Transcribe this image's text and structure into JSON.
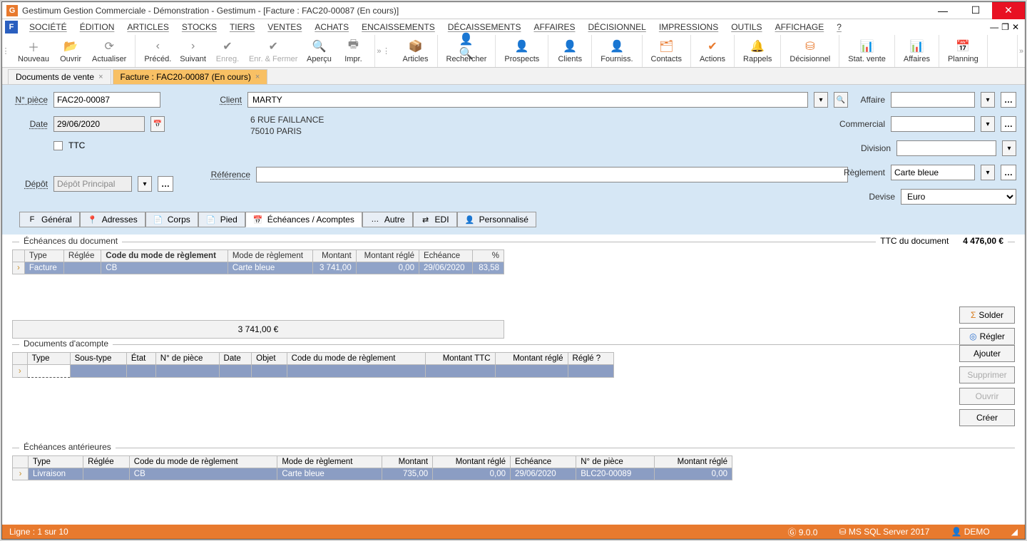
{
  "titlebar": "Gestimum Gestion Commerciale - Démonstration - Gestimum - [Facture : FAC20-00087 (En cours)]",
  "menus": [
    "SOCIÉTÉ",
    "ÉDITION",
    "ARTICLES",
    "STOCKS",
    "TIERS",
    "VENTES",
    "ACHATS",
    "ENCAISSEMENTS",
    "DÉCAISSEMENTS",
    "AFFAIRES",
    "DÉCISIONNEL",
    "IMPRESSIONS",
    "OUTILS",
    "AFFICHAGE",
    "?"
  ],
  "toolbar1": [
    {
      "label": "Nouveau",
      "icon": "＋",
      "color": "ic-grey"
    },
    {
      "label": "Ouvrir",
      "icon": "📂",
      "color": "ic-grey"
    },
    {
      "label": "Actualiser",
      "icon": "⟳",
      "color": "ic-grey"
    }
  ],
  "toolbar2": [
    {
      "label": "Précéd.",
      "icon": "‹",
      "color": "ic-grey"
    },
    {
      "label": "Suivant",
      "icon": "›",
      "color": "ic-grey"
    },
    {
      "label": "Enreg.",
      "icon": "✔",
      "color": "ic-grey",
      "disabled": true
    },
    {
      "label": "Enr. & Fermer",
      "icon": "✔",
      "color": "ic-grey",
      "disabled": true
    },
    {
      "label": "Aperçu",
      "icon": "🔍",
      "color": "ic-grey"
    },
    {
      "label": "Impr.",
      "icon": "🖶",
      "color": "ic-grey"
    }
  ],
  "toolbar3": [
    {
      "label": "Articles",
      "icon": "📦",
      "color": "ic-orange"
    },
    {
      "label": "Rechercher",
      "icon": "👤🔍",
      "color": "ic-orange"
    },
    {
      "label": "Prospects",
      "icon": "👤",
      "color": "ic-green"
    },
    {
      "label": "Clients",
      "icon": "👤",
      "color": "ic-orange"
    },
    {
      "label": "Fourniss.",
      "icon": "👤",
      "color": "ic-blue"
    },
    {
      "label": "Contacts",
      "icon": "🗂",
      "color": "ic-orange"
    },
    {
      "label": "Actions",
      "icon": "✔",
      "color": "ic-orange"
    },
    {
      "label": "Rappels",
      "icon": "🔔",
      "color": "ic-orange"
    },
    {
      "label": "Décisionnel",
      "icon": "⛁",
      "color": "ic-orange"
    },
    {
      "label": "Stat. vente",
      "icon": "📊",
      "color": "ic-blue"
    },
    {
      "label": "Affaires",
      "icon": "📊",
      "color": "ic-orange"
    },
    {
      "label": "Planning",
      "icon": "📅",
      "color": "ic-orange"
    }
  ],
  "tabs": [
    {
      "label": "Documents de vente",
      "active": false
    },
    {
      "label": "Facture : FAC20-00087 (En cours)",
      "active": true
    }
  ],
  "form": {
    "npiece_label": "N° pièce",
    "npiece": "FAC20-00087",
    "date_label": "Date",
    "date": "29/06/2020",
    "ttc_label": "TTC",
    "depot_label": "Dépôt",
    "depot": "Dépôt Principal",
    "client_label": "Client",
    "client": "MARTY",
    "addr1": "6 RUE FAILLANCE",
    "addr2": "75010 PARIS",
    "reference_label": "Référence",
    "reference": "",
    "affaire_label": "Affaire",
    "affaire": "",
    "commercial_label": "Commercial",
    "commercial": "",
    "division_label": "Division",
    "division": "",
    "reglement_label": "Règlement",
    "reglement": "Carte bleue",
    "devise_label": "Devise",
    "devise": "Euro"
  },
  "subtabs": [
    {
      "label": "Général",
      "icon": "F"
    },
    {
      "label": "Adresses",
      "icon": "📍"
    },
    {
      "label": "Corps",
      "icon": "📄"
    },
    {
      "label": "Pied",
      "icon": "📄"
    },
    {
      "label": "Échéances / Acomptes",
      "icon": "📅",
      "active": true
    },
    {
      "label": "Autre",
      "icon": "…"
    },
    {
      "label": "EDI",
      "icon": "⇄"
    },
    {
      "label": "Personnalisé",
      "icon": "👤"
    }
  ],
  "section1": {
    "legend": "Échéances du document",
    "ttc_label": "TTC du document",
    "ttc_value": "4 476,00 €",
    "headers": [
      "Type",
      "Réglée",
      "Code du mode de règlement",
      "Mode de règlement",
      "Montant",
      "Montant réglé",
      "Echéance",
      "%"
    ],
    "row": [
      "Facture",
      "",
      "CB",
      "Carte bleue",
      "3 741,00",
      "0,00",
      "29/06/2020",
      "83,58"
    ],
    "total": "3 741,00 €",
    "btn_solder": "Solder",
    "btn_regler": "Régler"
  },
  "section2": {
    "legend": "Documents d'acompte",
    "headers": [
      "Type",
      "Sous-type",
      "État",
      "N° de pièce",
      "Date",
      "Objet",
      "Code du mode de règlement",
      "Montant TTC",
      "Montant réglé",
      "Réglé ?"
    ],
    "btns": {
      "ajouter": "Ajouter",
      "supprimer": "Supprimer",
      "ouvrir": "Ouvrir",
      "creer": "Créer"
    }
  },
  "section3": {
    "legend": "Échéances antérieures",
    "headers": [
      "Type",
      "Réglée",
      "Code du mode de règlement",
      "Mode de règlement",
      "Montant",
      "Montant réglé",
      "Echéance",
      "N° de pièce",
      "Montant réglé"
    ],
    "row": [
      "Livraison",
      "",
      "CB",
      "Carte bleue",
      "735,00",
      "0,00",
      "29/06/2020",
      "BLC20-00089",
      "0,00"
    ]
  },
  "status": {
    "left": "Ligne : 1 sur 10",
    "version": "9.0.0",
    "server": "MS SQL Server 2017",
    "user": "DEMO"
  }
}
